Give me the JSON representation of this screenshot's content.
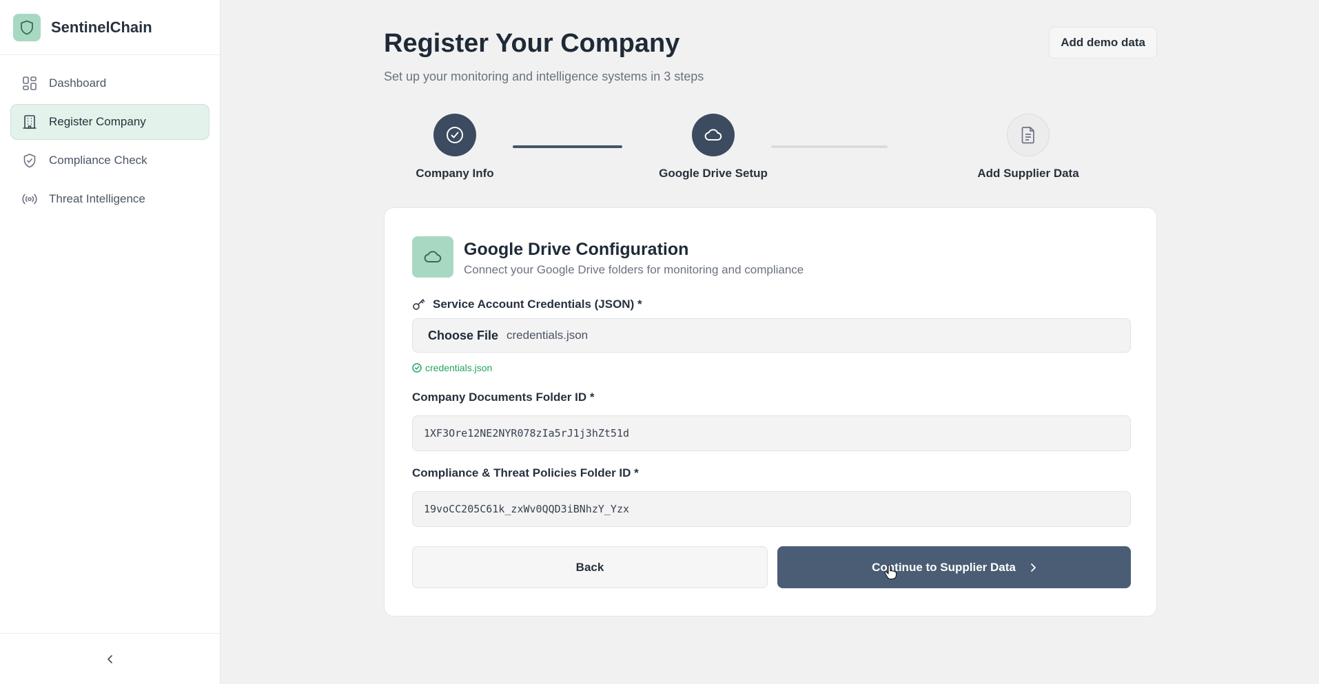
{
  "app": {
    "name": "SentinelChain",
    "logo_icon": "shield-icon"
  },
  "sidebar": {
    "items": [
      {
        "label": "Dashboard",
        "icon": "grid-icon",
        "active": false
      },
      {
        "label": "Register Company",
        "icon": "building-icon",
        "active": true
      },
      {
        "label": "Compliance Check",
        "icon": "shield-check-icon",
        "active": false
      },
      {
        "label": "Threat Intelligence",
        "icon": "radio-signal-icon",
        "active": false
      }
    ],
    "collapse_icon": "chevron-left-icon"
  },
  "header": {
    "title": "Register Your Company",
    "subtitle": "Set up your monitoring and intelligence systems in 3 steps",
    "demo_button": "Add demo data"
  },
  "stepper": {
    "steps": [
      {
        "label": "Company Info",
        "icon": "check-circle-icon",
        "state": "complete"
      },
      {
        "label": "Google Drive Setup",
        "icon": "cloud-icon",
        "state": "current"
      },
      {
        "label": "Add Supplier Data",
        "icon": "document-icon",
        "state": "pending"
      }
    ]
  },
  "card": {
    "icon": "cloud-icon",
    "title": "Google Drive Configuration",
    "subtitle": "Connect your Google Drive folders for monitoring and compliance",
    "credentials": {
      "label": "Service Account Credentials (JSON) *",
      "choose_file": "Choose File",
      "file_name": "credentials.json",
      "uploaded_status": "credentials.json"
    },
    "company_folder": {
      "label": "Company Documents Folder ID *",
      "value": "1XF3Ore12NE2NYR078zIa5rJ1j3hZt51d"
    },
    "policies_folder": {
      "label": "Compliance & Threat Policies Folder ID *",
      "value": "19voCC205C61k_zxWv0QQD3iBNhzY_Yzx"
    },
    "back_button": "Back",
    "continue_button": "Continue to Supplier Data"
  },
  "colors": {
    "accent_green": "#a9d8c2",
    "active_nav_bg": "#e3f2ea",
    "primary_button": "#4a5d75",
    "step_complete": "#3c4b5f",
    "success_text": "#22a45d"
  }
}
